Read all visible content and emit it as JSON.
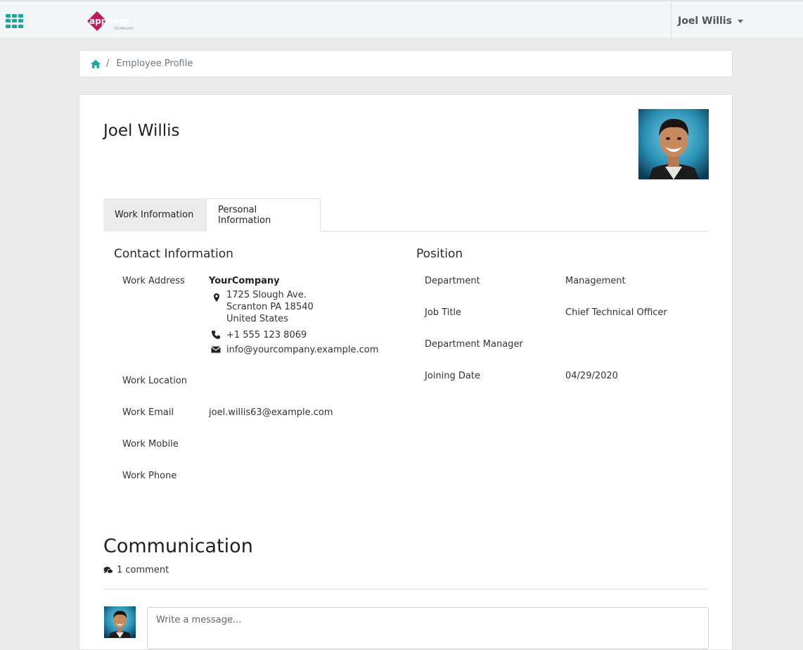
{
  "navbar": {
    "apps_icon": "grid-icon",
    "logo_text": "appness",
    "logo_subtext": "TECHNOLOGY",
    "user_name": "Joel Willis",
    "accent_color": "#1aa99b",
    "logo_color": "#c2185b"
  },
  "breadcrumb": {
    "home_icon": "home-icon",
    "separator": "/",
    "current": "Employee Profile"
  },
  "employee": {
    "name": "Joel Willis",
    "photo_icon": "employee-avatar"
  },
  "tabs": [
    {
      "label": "Work Information",
      "active": true
    },
    {
      "label": "Personal Information",
      "active": false
    }
  ],
  "contact": {
    "title": "Contact Information",
    "work_address_label": "Work Address",
    "company": "YourCompany",
    "address_lines": [
      "1725 Slough Ave.",
      "Scranton PA 18540",
      "United States"
    ],
    "phone": "+1 555 123 8069",
    "email": "info@yourcompany.example.com",
    "work_location_label": "Work Location",
    "work_location": "",
    "work_email_label": "Work Email",
    "work_email": "joel.willis63@example.com",
    "work_mobile_label": "Work Mobile",
    "work_mobile": "",
    "work_phone_label": "Work Phone",
    "work_phone": ""
  },
  "position": {
    "title": "Position",
    "department_label": "Department",
    "department": "Management",
    "job_title_label": "Job Title",
    "job_title": "Chief Technical Officer",
    "manager_label": "Department Manager",
    "manager": "",
    "joining_date_label": "Joining Date",
    "joining_date": "04/29/2020"
  },
  "communication": {
    "title": "Communication",
    "comment_count": "1 comment",
    "message_placeholder": "Write a message..."
  }
}
